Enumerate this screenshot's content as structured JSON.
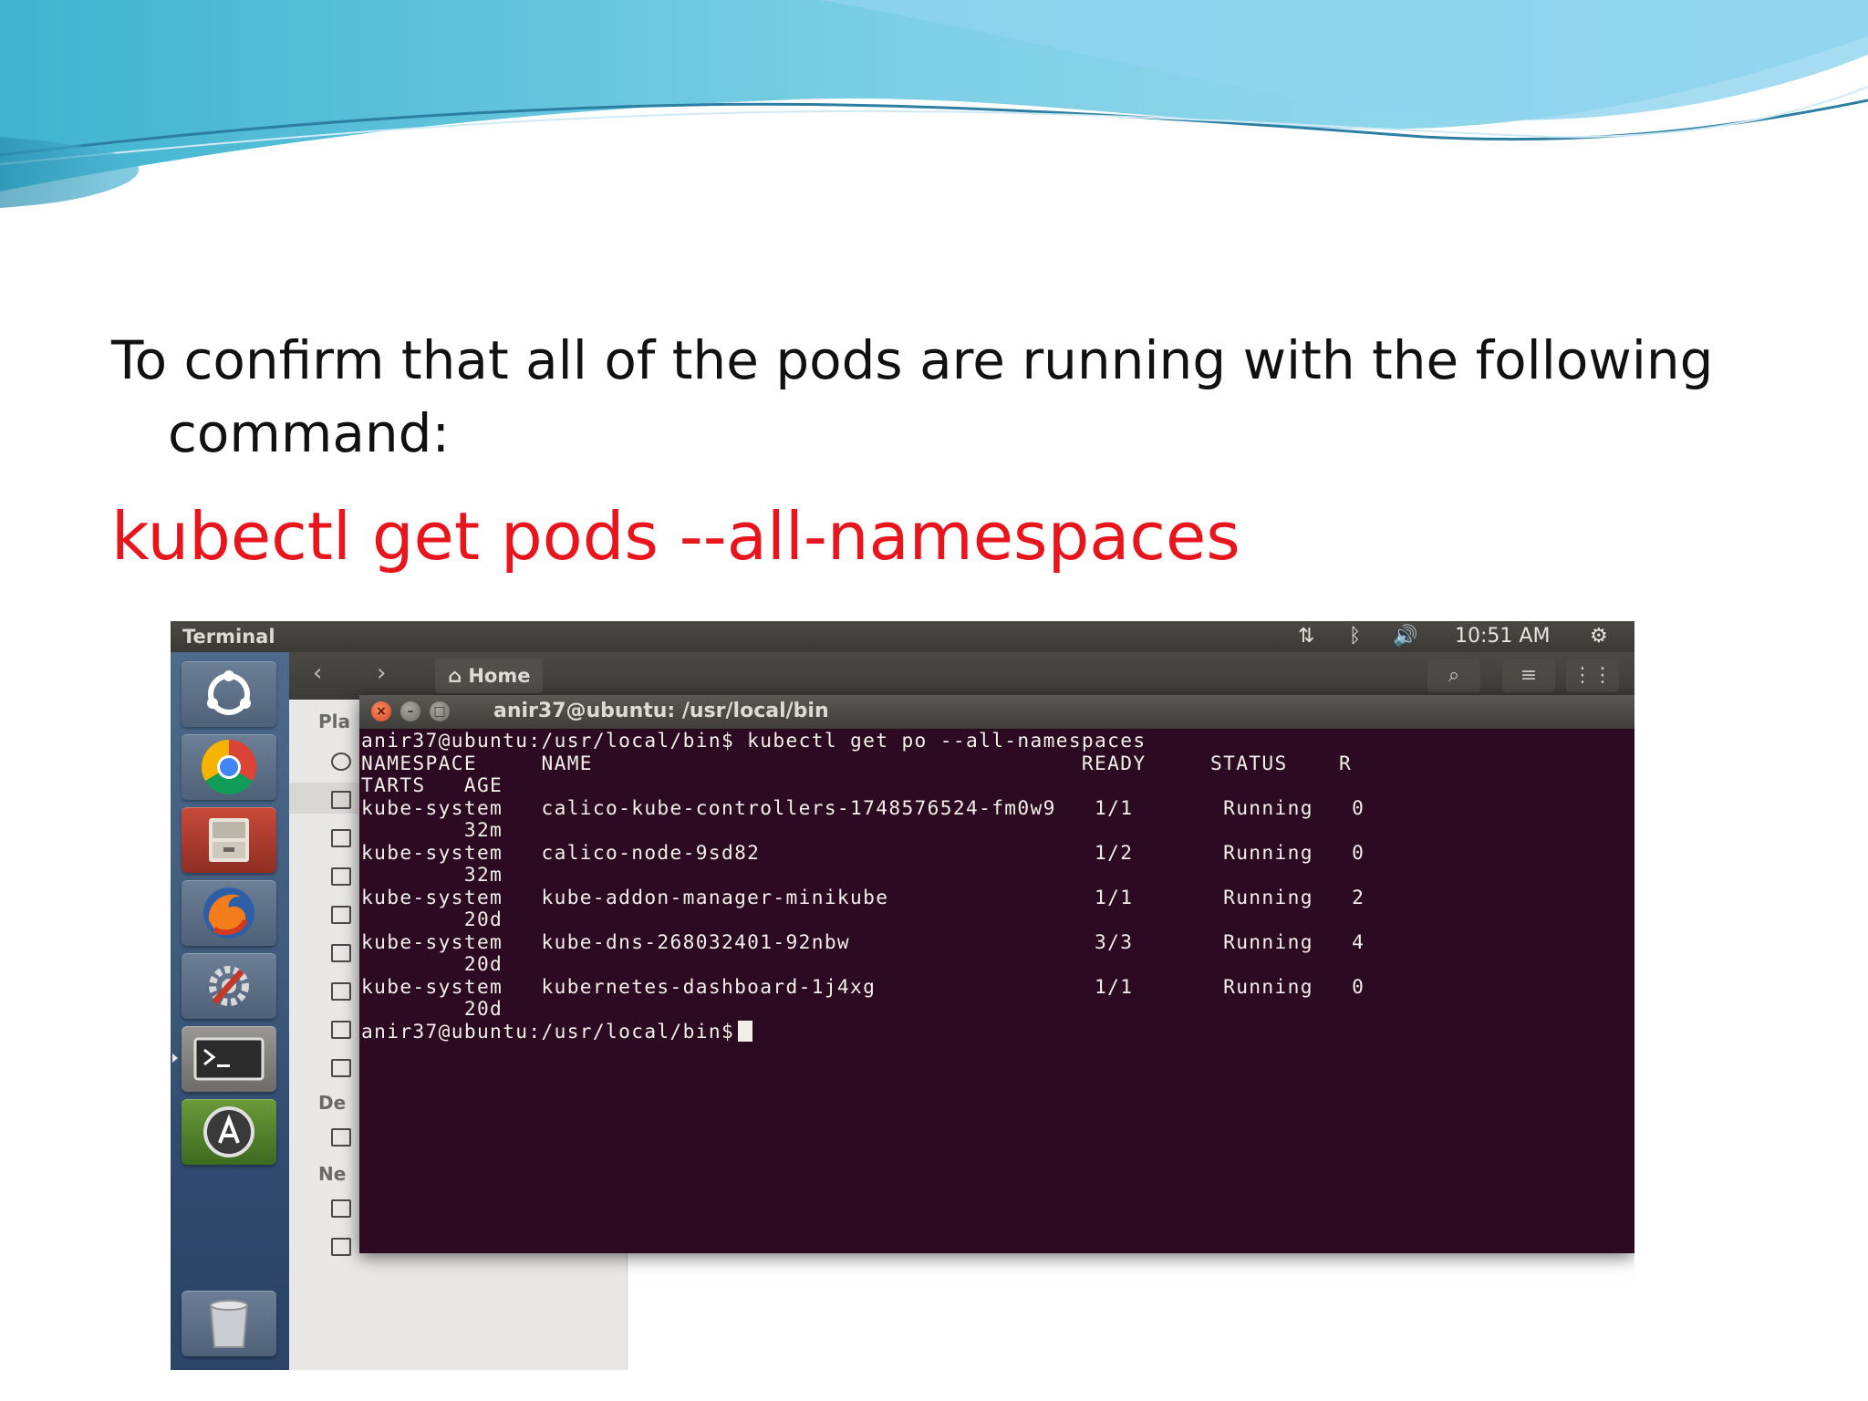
{
  "slide": {
    "instruction": "To confirm that all of the pods are running with the following command:",
    "command": "kubectl get pods --all-namespaces"
  },
  "top_panel": {
    "app_name": "Terminal",
    "network_icon": "network-updown-icon",
    "bluetooth_icon": "bluetooth-icon",
    "volume_icon": "volume-icon",
    "time": "10:51 AM",
    "settings_icon": "gear-power-icon"
  },
  "launcher": {
    "items": [
      "ubuntu-dash",
      "chrome",
      "files",
      "firefox",
      "system-settings",
      "terminal",
      "software-updater",
      "trash"
    ]
  },
  "file_manager": {
    "location": "Home",
    "sidebar_sections": [
      "Pla",
      "De",
      "Ne"
    ]
  },
  "terminal": {
    "title": "anir37@ubuntu: /usr/local/bin",
    "lines": [
      "anir37@ubuntu:/usr/local/bin$ kubectl get po --all-namespaces",
      "NAMESPACE     NAME                                      READY     STATUS    R",
      "TARTS   AGE",
      "kube-system   calico-kube-controllers-1748576524-fm0w9   1/1       Running   0",
      "        32m",
      "kube-system   calico-node-9sd82                          1/2       Running   0",
      "        32m",
      "kube-system   kube-addon-manager-minikube                1/1       Running   2",
      "        20d",
      "kube-system   kube-dns-268032401-92nbw                   3/3       Running   4",
      "        20d",
      "kube-system   kubernetes-dashboard-1j4xg                 1/1       Running   0",
      "        20d"
    ],
    "prompt": "anir37@ubuntu:/usr/local/bin$"
  }
}
